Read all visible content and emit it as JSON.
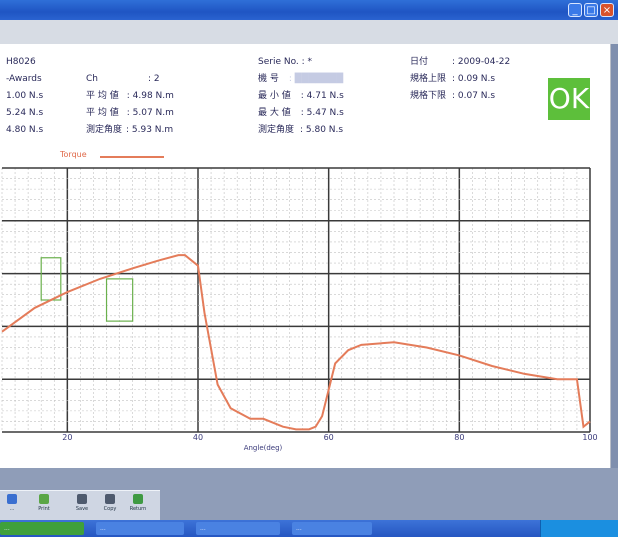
{
  "window": {
    "minimize_icon": "minimize-icon",
    "maximize_icon": "maximize-icon",
    "close_icon": "close-icon",
    "close_color": "#d9532c"
  },
  "report": {
    "col_a": [
      "H8026",
      "-Awards",
      "1.00 N.s",
      "5.24 N.s",
      "4.80 N.s"
    ],
    "col_b": [
      "Ch",
      "平 均 値",
      "平 均 値",
      "測定角度"
    ],
    "col_b_values": [
      ": 2",
      ": 4.98 N.m",
      ": 5.07 N.m",
      ": 5.93 N.m"
    ],
    "col_c": [
      "Serie No. : *",
      "機    号",
      "最 小 値",
      "最 大 値",
      "測定角度"
    ],
    "col_c_values": [
      "",
      ": ███████",
      ": 4.71 N.s",
      ": 5.47 N.s",
      ": 5.80 N.s"
    ],
    "col_d": [
      "日付",
      "規格上限",
      "規格下限"
    ],
    "col_d_values": [
      ": 2009-04-22",
      ": 0.09 N.s",
      ": 0.07 N.s"
    ],
    "verdict": "OK",
    "verdict_color": "#5dbf3b"
  },
  "chart_data": {
    "type": "line",
    "legend": "Torque",
    "xlabel": "Angle(deg)",
    "xlim": [
      10,
      100
    ],
    "ylim": [
      0,
      1
    ],
    "x_ticks": [
      20,
      40,
      60,
      80,
      100
    ],
    "x_tick_labels": [
      "20",
      "40",
      "60",
      "80",
      "100"
    ],
    "grid": true,
    "line_color": "#e47c5a",
    "series": [
      {
        "name": "Torque",
        "x": [
          10,
          15,
          20,
          25,
          30,
          34,
          37,
          38,
          40,
          41,
          43,
          45,
          48,
          50,
          53,
          55,
          57,
          58,
          59,
          60,
          61,
          63,
          65,
          70,
          75,
          80,
          85,
          90,
          95,
          98,
          99,
          100
        ],
        "y": [
          0.38,
          0.47,
          0.53,
          0.58,
          0.62,
          0.65,
          0.67,
          0.67,
          0.63,
          0.45,
          0.18,
          0.09,
          0.05,
          0.05,
          0.02,
          0.01,
          0.01,
          0.02,
          0.06,
          0.16,
          0.26,
          0.31,
          0.33,
          0.34,
          0.32,
          0.29,
          0.25,
          0.22,
          0.2,
          0.2,
          0.02,
          0.04
        ]
      }
    ],
    "markers": [
      {
        "x_range": [
          16,
          19
        ],
        "y_range": [
          0.5,
          0.66
        ]
      },
      {
        "x_range": [
          26,
          30
        ],
        "y_range": [
          0.42,
          0.58
        ]
      }
    ],
    "marker_color": "#6ab04c"
  },
  "toolbar": {
    "items": [
      {
        "label": "...",
        "icon": "info-icon"
      },
      {
        "label": "Print",
        "icon": "print-icon"
      },
      {
        "label": "Save",
        "icon": "save-icon"
      },
      {
        "label": "Copy",
        "icon": "copy-icon"
      },
      {
        "label": "Return",
        "icon": "return-icon"
      }
    ]
  },
  "taskbar": {
    "start_label": "...",
    "tasks": [
      "...",
      "...",
      "..."
    ]
  }
}
